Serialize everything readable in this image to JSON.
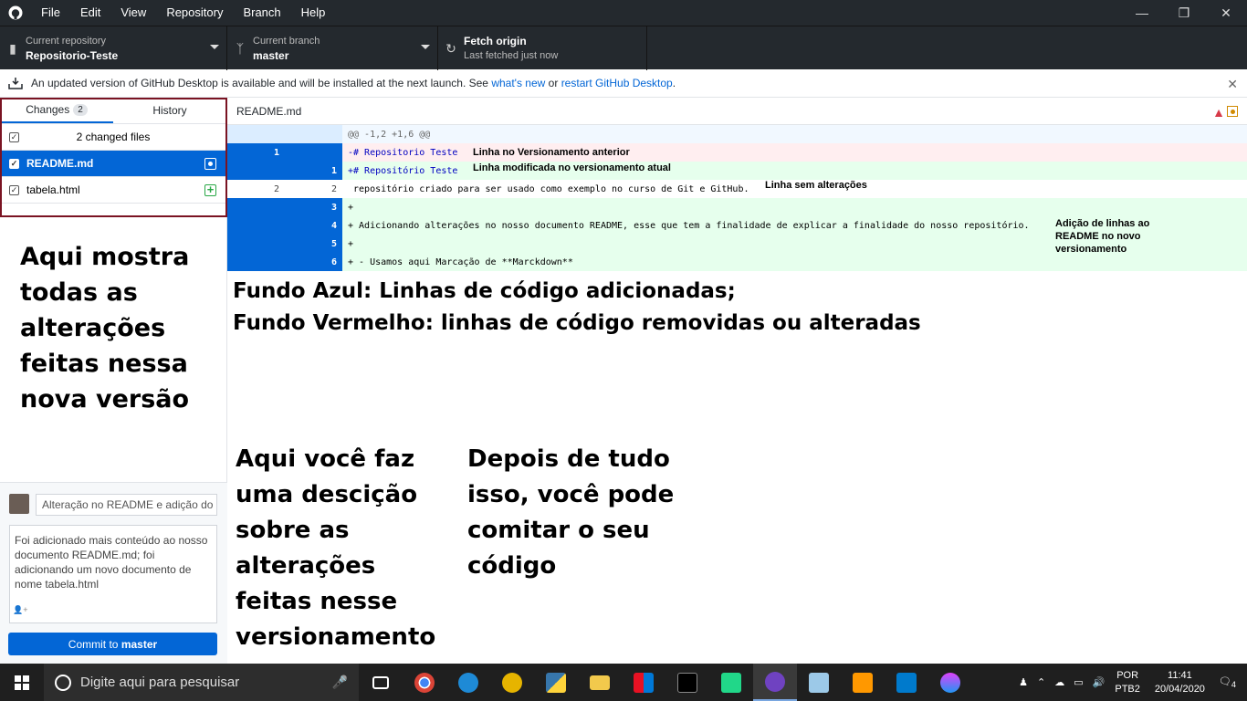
{
  "menu": [
    "File",
    "Edit",
    "View",
    "Repository",
    "Branch",
    "Help"
  ],
  "toolbar": {
    "repo_label": "Current repository",
    "repo_value": "Repositorio-Teste",
    "branch_label": "Current branch",
    "branch_value": "master",
    "fetch_label": "Fetch origin",
    "fetch_sub": "Last fetched just now"
  },
  "banner": {
    "text": "An updated version of GitHub Desktop is available and will be installed at the next launch. See",
    "link1": "what's new",
    "or": "or",
    "link2": "restart GitHub Desktop",
    "period": "."
  },
  "sidebar": {
    "tab_changes": "Changes",
    "changes_count": "2",
    "tab_history": "History",
    "changed_files": "2 changed files",
    "files": [
      {
        "name": "README.md",
        "status": "modified"
      },
      {
        "name": "tabela.html",
        "status": "added"
      }
    ]
  },
  "commit": {
    "summary": "Alteração no README e adição do a",
    "description": "Foi adicionado mais conteúdo ao nosso documento README.md; foi adicionando um novo documento de nome tabela.html",
    "button_prefix": "Commit to ",
    "button_branch": "master"
  },
  "diff": {
    "file": "README.md",
    "hunk": "@@ -1,2 +1,6 @@",
    "lines": [
      {
        "type": "del",
        "old": "1",
        "new": "",
        "code": "-# Repositorio Teste"
      },
      {
        "type": "add",
        "old": "",
        "new": "1",
        "code": "+# Repositório Teste"
      },
      {
        "type": "ctx",
        "old": "2",
        "new": "2",
        "code": " repositório criado para ser usado como exemplo no curso de Git e GitHub."
      },
      {
        "type": "add",
        "old": "",
        "new": "3",
        "code": "+"
      },
      {
        "type": "add",
        "old": "",
        "new": "4",
        "code": "+ Adicionando alterações no nosso documento README, esse que tem a finalidade de explicar a finalidade do nosso repositório."
      },
      {
        "type": "add",
        "old": "",
        "new": "5",
        "code": "+"
      },
      {
        "type": "add",
        "old": "",
        "new": "6",
        "code": "+ - Usamos aqui Marcação de **Marckdown**"
      }
    ],
    "notes": {
      "removed": "Linha no Versionamento anterior",
      "modified": "Linha modificada no versionamento atual",
      "unchanged": "Linha sem alterações",
      "added": "Adição de linhas ao README no novo versionamento"
    }
  },
  "annotations": {
    "sidebar_note": "Aqui mostra todas as alterações feitas nessa nova versão",
    "legend_blue": "Fundo Azul: Linhas de código adicionadas;",
    "legend_red": "Fundo Vermelho: linhas de código removidas ou alteradas",
    "description_note": "Aqui você faz uma descição sobre as alterações feitas nesse versionamento",
    "commit_note": "Depois de tudo isso, você pode comitar o seu código"
  },
  "taskbar": {
    "search_placeholder": "Digite aqui para pesquisar",
    "lang1": "POR",
    "lang2": "PTB2",
    "time": "11:41",
    "date": "20/04/2020",
    "notifications": "4"
  },
  "colors": {
    "accent": "#0366d6",
    "titlebar": "#24292e",
    "annotation_border": "#7a1322",
    "added_bg": "#e6ffed",
    "removed_bg": "#ffeef0"
  }
}
